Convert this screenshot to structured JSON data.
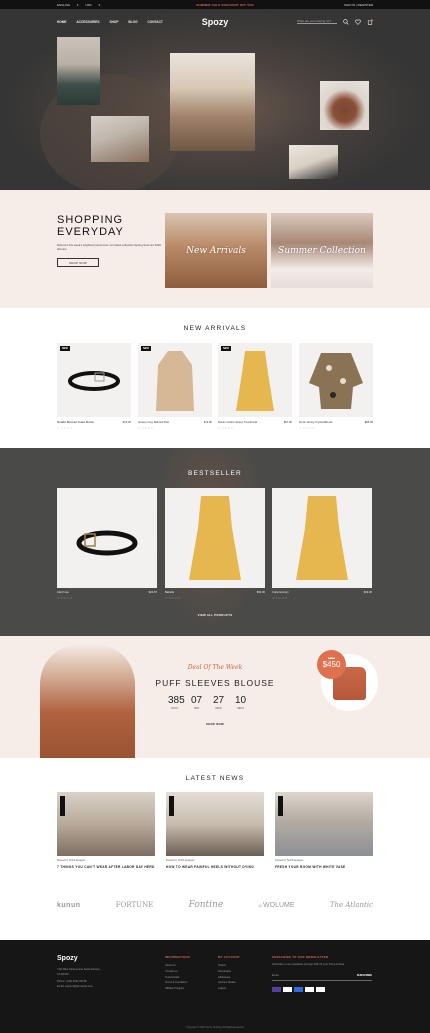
{
  "topbar": {
    "language": "ENGLISH",
    "currency": "USD",
    "promo": "SUMMER SALE DISCOUNT OFF 50%",
    "account": "SIGN IN | REGISTER"
  },
  "nav": {
    "items": [
      "HOME",
      "ACCESSORIES",
      "SHOP",
      "BLOG",
      "CONTACT"
    ],
    "logo": "Spozy",
    "search_placeholder": "What are you looking for?",
    "cart_count": "0"
  },
  "shop": {
    "title_line1": "SHOPPING",
    "title_line2": "EVERYDAY",
    "description": "Discover this week's brightest pieces from our latest collection Spring Summer 2020 Women",
    "button": "SHOP NOW",
    "card1": "New Arrivals",
    "card2": "Summer Collection"
  },
  "new_arrivals": {
    "title": "NEW ARRIVALS",
    "products": [
      {
        "badge": "NEW",
        "name": "Metallic Bracelet Snake Buckle",
        "price": "$73.30"
      },
      {
        "badge": "NEW",
        "name": "Jersey Long Tailored Shirt",
        "price": "$72.00"
      },
      {
        "badge": "NEW",
        "name": "Denim Cotton Jersey Trenchcoat",
        "price": "$67.00"
      },
      {
        "badge": "",
        "name": "Frock Jersey Crystal Blouse",
        "price": "$85.90"
      }
    ]
  },
  "bestseller": {
    "title": "BESTSELLER",
    "products": [
      {
        "name": "Ulet Knee",
        "price": "$22.87"
      },
      {
        "name": "Babella",
        "price": "$50.00"
      },
      {
        "name": "Corla Gomery",
        "price": "$33.00"
      }
    ],
    "view_all": "VIEW ALL PRODUCTS"
  },
  "deal": {
    "script": "Deal Of The Week",
    "title": "PUFF SLEEVES BLOUSE",
    "countdown": [
      {
        "value": "385",
        "label": "DAYS"
      },
      {
        "value": "07",
        "label": "HRS"
      },
      {
        "value": "27",
        "label": "MINS"
      },
      {
        "value": "10",
        "label": "SECS"
      }
    ],
    "shop_now": "SHOP NOW",
    "old_price": "$560",
    "new_price": "$450"
  },
  "news": {
    "title": "LATEST NEWS",
    "posts": [
      {
        "by": "Posted by Smith designer",
        "title": "7 THINGS YOU CAN'T WEAR AFTER LABOR DAY HERD"
      },
      {
        "by": "Posted by Smith designer",
        "title": "HOW TO WEAR PAINFUL HEELS WITHOUT DYING"
      },
      {
        "by": "Posted by Smith designer",
        "title": "FRESH YOUR ROOM WITH WHITE VASE"
      }
    ],
    "brands": [
      "kunun",
      "FORTUNE",
      "Fontine",
      "WOLUME",
      "The Atlantic"
    ]
  },
  "footer": {
    "logo": "Spozy",
    "address": [
      "7111 Blue Spring Lane Santa Monica,",
      "CA 90420",
      "Phone: (+84) 3312 20728",
      "Email: support@domainss.com"
    ],
    "info_title": "INFORMATIONS",
    "info_items": [
      "About Us",
      "Contact us",
      "Testimonials",
      "Terms & Conditions",
      "Affiliate Program"
    ],
    "account_title": "MY ACCOUNT",
    "account_items": [
      "Orders",
      "Downloads",
      "Addresses",
      "Account details",
      "Logout"
    ],
    "newsletter_title": "SUBSCRIBE TO OUR NEWSLETTER",
    "newsletter_text": "Subscribe to our newsletter and get 10% off your first purchase",
    "email_placeholder": "Email",
    "subscribe": "SUBSCRIBE",
    "copyright": "Copyright © 2020 Spozy Clothing. All Rights Reserved"
  }
}
